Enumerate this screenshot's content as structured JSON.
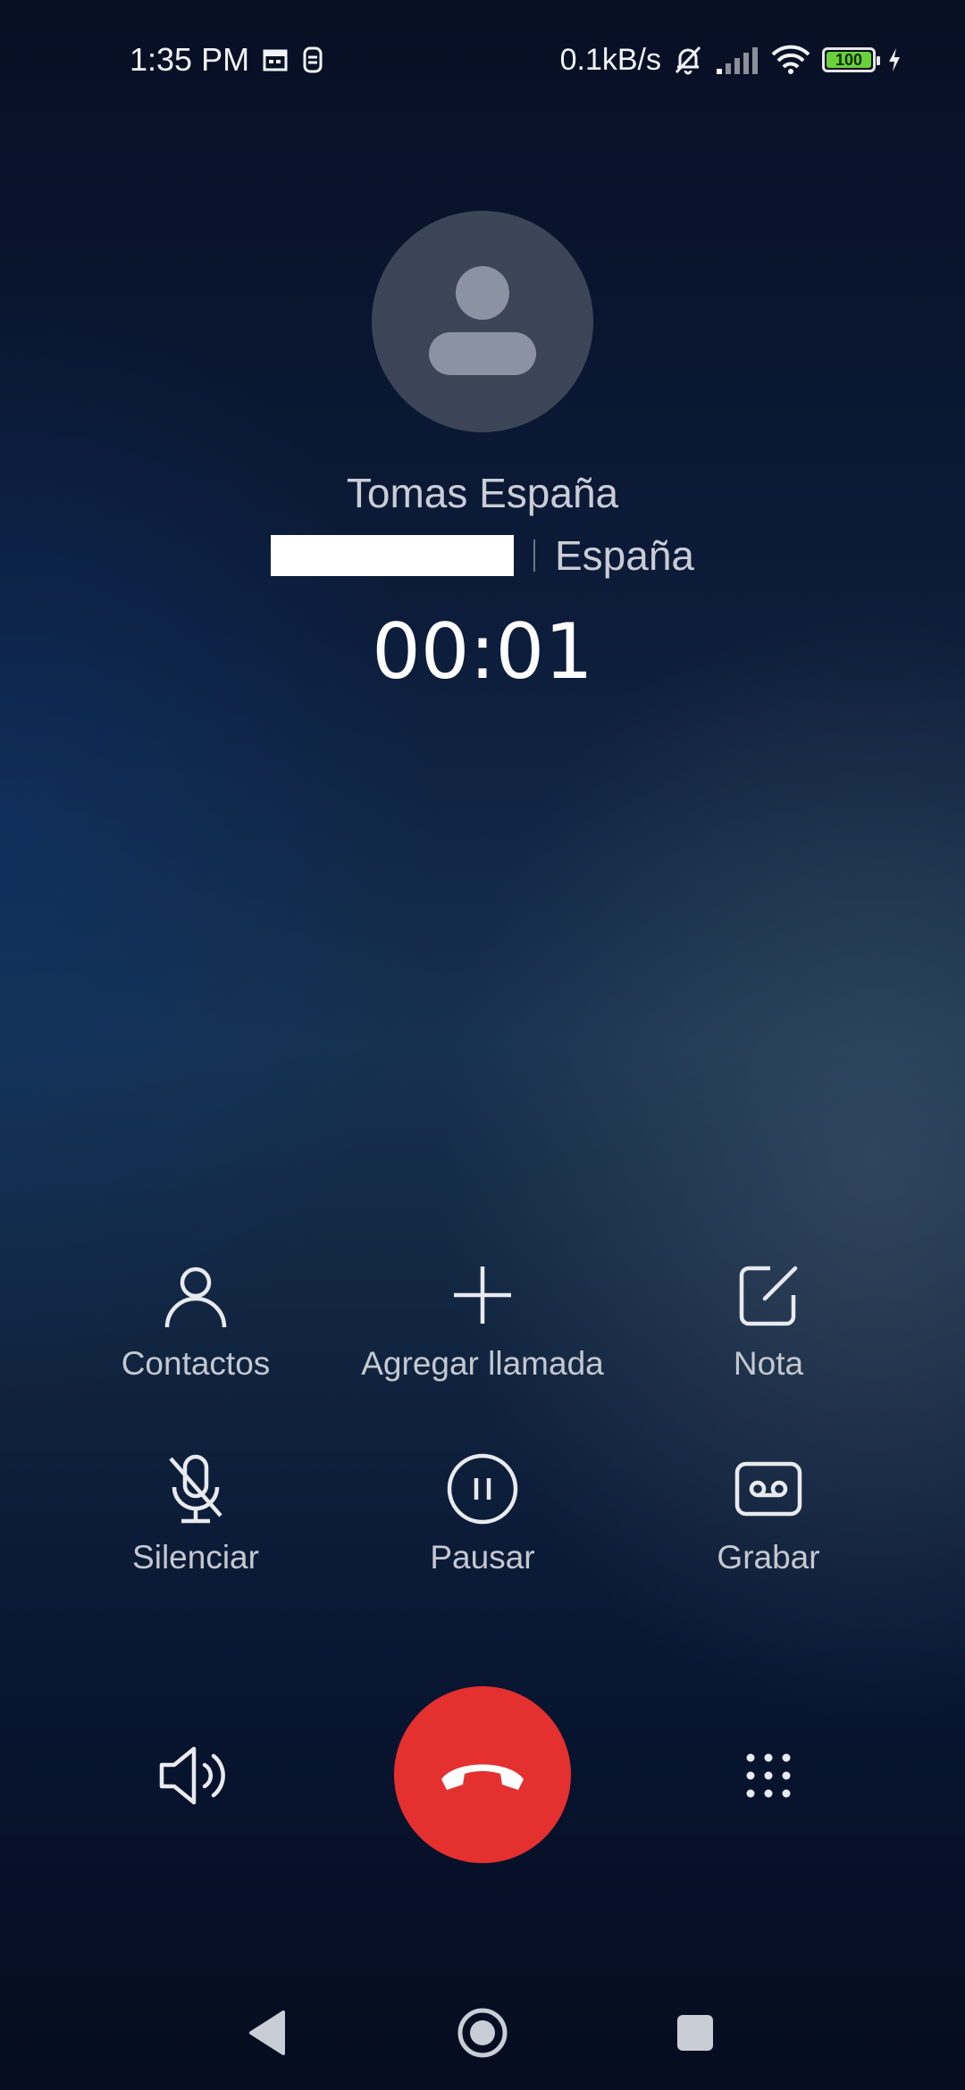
{
  "status_bar": {
    "time": "1:35 PM",
    "net_speed": "0.1kB/s",
    "battery_level": "100",
    "icons": [
      "calendar-icon",
      "vpn-icon",
      "bell-muted-icon",
      "signal-icon",
      "wifi-icon",
      "battery-icon",
      "charging-icon"
    ]
  },
  "caller": {
    "name": "Tomas España",
    "location": "España",
    "duration": "00:01"
  },
  "actions": {
    "contacts": "Contactos",
    "add_call": "Agregar llamada",
    "note": "Nota",
    "mute": "Silenciar",
    "hold": "Pausar",
    "record": "Grabar"
  },
  "controls": {
    "speaker_icon": "speaker-icon",
    "end_call_icon": "end-call-icon",
    "keypad_icon": "keypad-icon",
    "end_call_color": "#e53030"
  },
  "nav": {
    "icons": [
      "back-icon",
      "home-icon",
      "recents-icon"
    ]
  }
}
